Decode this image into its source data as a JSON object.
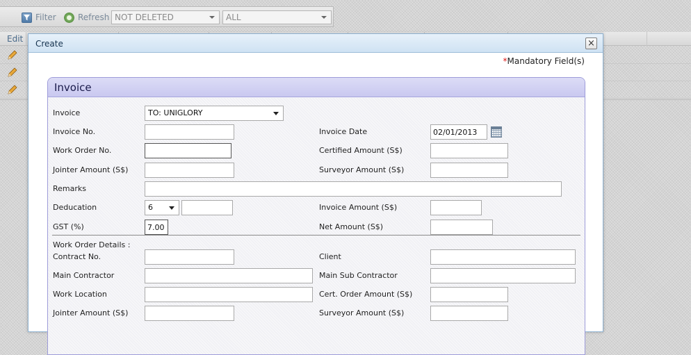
{
  "toolbar": {
    "filter_label": "Filter",
    "refresh_label": "Refresh",
    "status_select": "NOT DELETED",
    "scope_select": "ALL"
  },
  "grid": {
    "edit_header": "Edit",
    "row_count": 3
  },
  "dialog": {
    "title": "Create",
    "close_glyph": "×",
    "mandatory_star": "*",
    "mandatory_text": "Mandatory Field(s)"
  },
  "invoice": {
    "panel_title": "Invoice",
    "invoice_label": "Invoice",
    "invoice_select": "TO: UNIGLORY",
    "invoice_no_label": "Invoice No.",
    "invoice_no_value": "",
    "invoice_date_label": "Invoice Date",
    "invoice_date_value": "02/01/2013",
    "work_order_no_label": "Work Order No.",
    "work_order_no_value": "",
    "certified_amount_label": "Certified Amount (S$)",
    "certified_amount_value": "",
    "jointer_amount_label": "Jointer Amount (S$)",
    "jointer_amount_value": "",
    "surveyor_amount_label": "Surveyor Amount (S$)",
    "surveyor_amount_value": "",
    "remarks_label": "Remarks",
    "remarks_value": "",
    "deduction_label": "Deducation",
    "deduction_select": "6",
    "deduction_value": "",
    "invoice_amount_label": "Invoice Amount (S$)",
    "invoice_amount_value": "",
    "gst_label": "GST (%)",
    "gst_value": "7.00",
    "net_amount_label": "Net Amount (S$)",
    "net_amount_value": ""
  },
  "work_order": {
    "section_title": "Work Order Details :",
    "contract_no_label": "Contract No.",
    "client_label": "Client",
    "main_contractor_label": "Main Contractor",
    "main_sub_contractor_label": "Main Sub Contractor",
    "work_location_label": "Work Location",
    "cert_order_amount_label": "Cert. Order Amount (S$)",
    "jointer_amount_label": "Jointer Amount (S$)",
    "surveyor_amount_label": "Surveyor Amount (S$)"
  },
  "colors": {
    "dialog_border": "#8fb2d1",
    "panel_border": "#9d9bd9",
    "mandatory_star": "#dd1111"
  }
}
